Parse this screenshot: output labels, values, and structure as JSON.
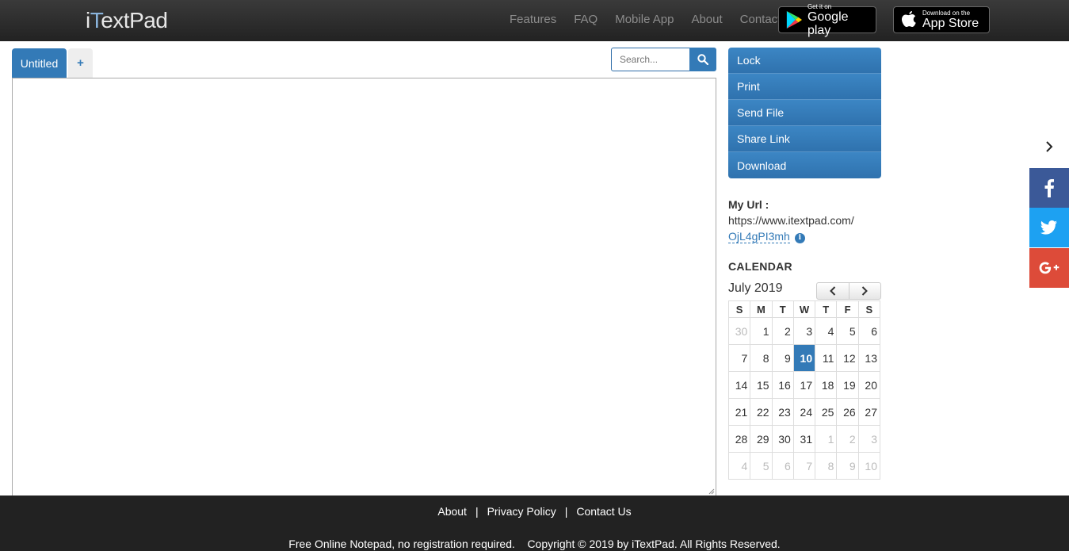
{
  "header": {
    "logo": "iTextPad",
    "nav": [
      "Features",
      "FAQ",
      "Mobile App",
      "About",
      "Contact"
    ],
    "google_play": {
      "small": "Get it on",
      "big": "Google play"
    },
    "app_store": {
      "small": "Download on the",
      "big": "App Store"
    }
  },
  "tabs": {
    "active": "Untitled",
    "add": "+"
  },
  "search": {
    "placeholder": "Search..."
  },
  "menu": [
    "Lock",
    "Print",
    "Send File",
    "Share Link",
    "Download"
  ],
  "myurl": {
    "label": "My Url :",
    "base": "https://www.itextpad.com/",
    "slug": "OjL4gPI3mh"
  },
  "calendar": {
    "title": "CALENDAR",
    "month": "July 2019",
    "weekdays": [
      "S",
      "M",
      "T",
      "W",
      "T",
      "F",
      "S"
    ],
    "weeks": [
      [
        {
          "d": "30",
          "m": true
        },
        {
          "d": "1"
        },
        {
          "d": "2"
        },
        {
          "d": "3"
        },
        {
          "d": "4"
        },
        {
          "d": "5"
        },
        {
          "d": "6"
        }
      ],
      [
        {
          "d": "7"
        },
        {
          "d": "8"
        },
        {
          "d": "9"
        },
        {
          "d": "10",
          "today": true
        },
        {
          "d": "11"
        },
        {
          "d": "12"
        },
        {
          "d": "13"
        }
      ],
      [
        {
          "d": "14"
        },
        {
          "d": "15"
        },
        {
          "d": "16"
        },
        {
          "d": "17"
        },
        {
          "d": "18"
        },
        {
          "d": "19"
        },
        {
          "d": "20"
        }
      ],
      [
        {
          "d": "21"
        },
        {
          "d": "22"
        },
        {
          "d": "23"
        },
        {
          "d": "24"
        },
        {
          "d": "25"
        },
        {
          "d": "26"
        },
        {
          "d": "27"
        }
      ],
      [
        {
          "d": "28"
        },
        {
          "d": "29"
        },
        {
          "d": "30"
        },
        {
          "d": "31"
        },
        {
          "d": "1",
          "m": true
        },
        {
          "d": "2",
          "m": true
        },
        {
          "d": "3",
          "m": true
        }
      ],
      [
        {
          "d": "4",
          "m": true
        },
        {
          "d": "5",
          "m": true
        },
        {
          "d": "6",
          "m": true
        },
        {
          "d": "7",
          "m": true
        },
        {
          "d": "8",
          "m": true
        },
        {
          "d": "9",
          "m": true
        },
        {
          "d": "10",
          "m": true
        }
      ]
    ]
  },
  "social": [
    "facebook-icon",
    "twitter-icon",
    "google-plus-icon"
  ],
  "footer": {
    "links": [
      "About",
      "Privacy Policy",
      "Contact Us"
    ],
    "separator": "|",
    "copy": "Free Online Notepad, no registration required.    Copyright © 2019 by iTextPad. All Rights Reserved."
  },
  "colors": {
    "accent": "#337ab7",
    "header_bg": "#2b2b2b",
    "facebook": "#3b5998",
    "twitter": "#1da1f2",
    "google_plus": "#dd4b39"
  }
}
